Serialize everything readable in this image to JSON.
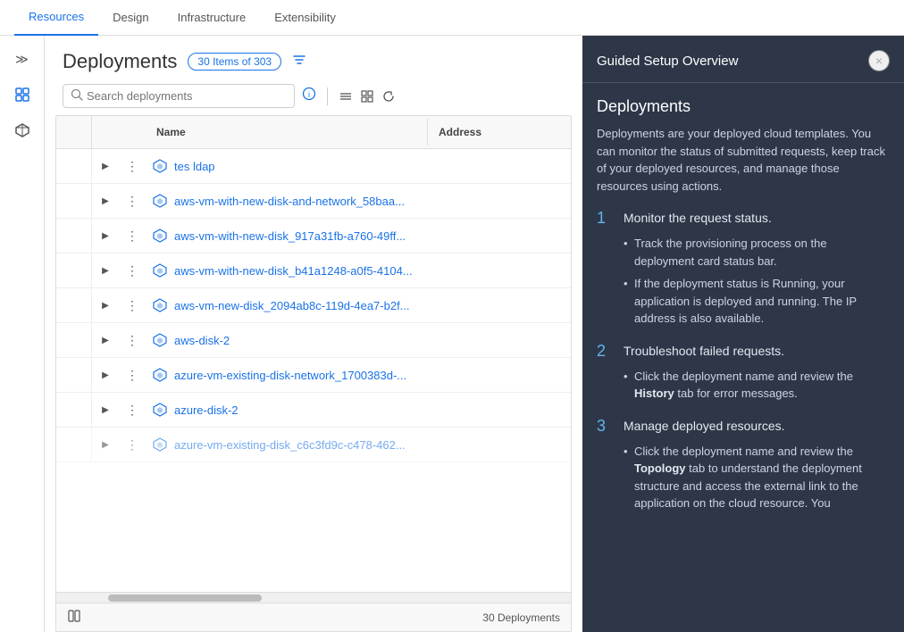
{
  "nav": {
    "tabs": [
      {
        "label": "Resources",
        "active": true
      },
      {
        "label": "Design",
        "active": false
      },
      {
        "label": "Infrastructure",
        "active": false
      },
      {
        "label": "Extensibility",
        "active": false
      }
    ]
  },
  "sidebar": {
    "icons": [
      {
        "name": "collapse-icon",
        "symbol": "≫"
      },
      {
        "name": "diamond-icon",
        "symbol": "◇"
      },
      {
        "name": "cube-icon",
        "symbol": "⬡"
      }
    ]
  },
  "deployments": {
    "title": "Deployments",
    "badge": "30 Items of 303",
    "search_placeholder": "Search deployments",
    "columns": [
      {
        "label": "Name"
      },
      {
        "label": "Address"
      }
    ],
    "rows": [
      {
        "name": "tes ldap",
        "address": ""
      },
      {
        "name": "aws-vm-with-new-disk-and-network_58baa...",
        "address": ""
      },
      {
        "name": "aws-vm-with-new-disk_917a31fb-a760-49ff...",
        "address": ""
      },
      {
        "name": "aws-vm-with-new-disk_b41a1248-a0f5-4104...",
        "address": ""
      },
      {
        "name": "aws-vm-new-disk_2094ab8c-119d-4ea7-b2f...",
        "address": ""
      },
      {
        "name": "aws-disk-2",
        "address": ""
      },
      {
        "name": "azure-vm-existing-disk-network_1700383d-...",
        "address": ""
      },
      {
        "name": "azure-disk-2",
        "address": ""
      },
      {
        "name": "azure-vm-existing-disk_c6c3fd9c-c478-462...",
        "address": ""
      }
    ],
    "footer_count": "30 Deployments"
  },
  "guided_setup": {
    "panel_title": "Guided Setup Overview",
    "section_title": "Deployments",
    "description": "Deployments are your deployed cloud templates. You can monitor the status of submitted requests, keep track of your deployed resources, and manage those resources using actions.",
    "steps": [
      {
        "number": "1",
        "title": "Monitor the request status.",
        "bullets": [
          "Track the provisioning process on the deployment card status bar.",
          "If the deployment status is Running, your application is deployed and running. The IP address is also available."
        ]
      },
      {
        "number": "2",
        "title": "Troubleshoot failed requests.",
        "bullets": [
          {
            "text": "Click the deployment name and review the ",
            "bold": "History",
            "suffix": " tab for error messages."
          }
        ]
      },
      {
        "number": "3",
        "title": "Manage deployed resources.",
        "bullets": [
          {
            "text": "Click the deployment name and review the ",
            "bold": "Topology",
            "suffix": " tab to understand the deployment structure and access the external link to the application on the cloud resource. You"
          }
        ]
      }
    ],
    "close_label": "×"
  }
}
